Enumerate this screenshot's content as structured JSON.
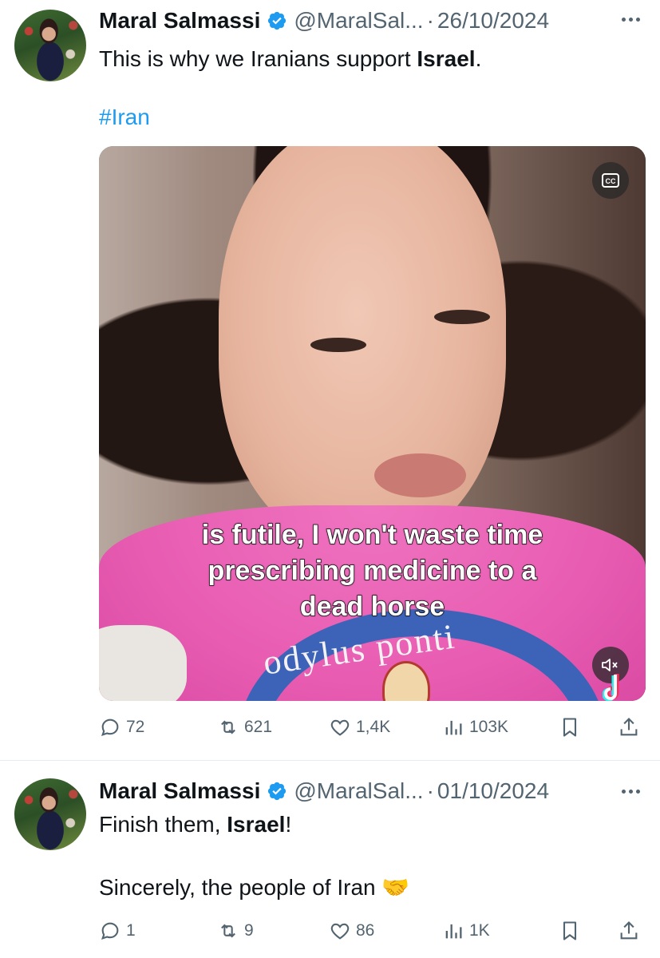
{
  "tweets": [
    {
      "author_name": "Maral Salmassi",
      "handle": "@MaralSal...",
      "separator": "·",
      "date": "26/10/2024",
      "text_prefix": "This is why we Iranians support ",
      "text_bold": "Israel",
      "text_suffix": ".",
      "hashtag": "#Iran",
      "media": {
        "caption_lines": [
          "is futile, I won't waste time",
          "prescribing medicine to a",
          "dead horse"
        ],
        "shirt_text": "odylus ponti",
        "cc_icon": "closed-captions-icon",
        "mute_icon": "muted-speaker-icon"
      },
      "actions": {
        "replies": "72",
        "reposts": "621",
        "likes": "1,4K",
        "views": "103K"
      }
    },
    {
      "author_name": "Maral Salmassi",
      "handle": "@MaralSal...",
      "separator": "·",
      "date": "01/10/2024",
      "line1_prefix": "Finish them, ",
      "line1_bold": "Israel",
      "line1_suffix": "!",
      "line2_text": "Sincerely, the people of Iran",
      "line2_emoji": "🤝",
      "actions": {
        "replies": "1",
        "reposts": "9",
        "likes": "86",
        "views": "1K"
      }
    }
  ],
  "colors": {
    "verified": "#1d9bf0",
    "link": "#1d9bf0",
    "muted_text": "#536471",
    "emoji": "#f5b428"
  }
}
